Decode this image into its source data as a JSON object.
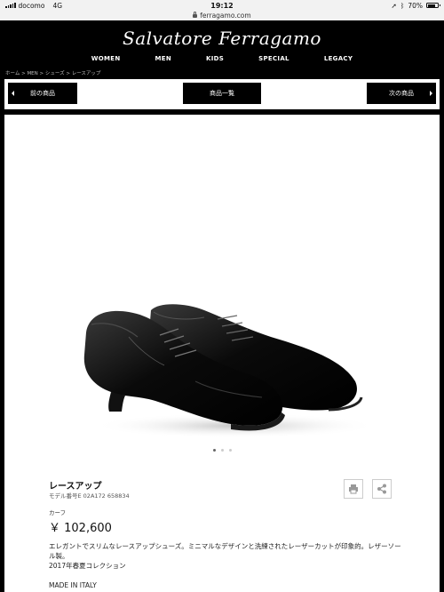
{
  "status_bar": {
    "carrier": "docomo",
    "network": "4G",
    "time": "19:12",
    "battery_percent": "70%",
    "battery_level": 0.7
  },
  "browser": {
    "url": "ferragamo.com"
  },
  "header": {
    "logo": "Salvatore Ferragamo",
    "nav": [
      "WOMEN",
      "MEN",
      "KIDS",
      "SPECIAL",
      "LEGACY"
    ]
  },
  "breadcrumb": "ホーム > MEN > シューズ > レースアップ",
  "pager": {
    "prev_label": "前の商品",
    "list_label": "商品一覧",
    "next_label": "次の商品"
  },
  "carousel": {
    "slide_count": 3,
    "active_index": 0
  },
  "product": {
    "name": "レースアップ",
    "model": "モデル番号E 02A172 658834",
    "material": "カーフ",
    "price": "￥ 102,600",
    "description": "エレガントでスリムなレースアップシューズ。ミニマルなデザインと洗練されたレーザーカットが印象的。レザーソール製。",
    "season": "2017年春夏コレクション",
    "origin": "MADE IN ITALY"
  },
  "icons": {
    "print": "print-icon",
    "share": "share-icon"
  },
  "colors": {
    "header_bg": "#000000",
    "header_text": "#ffffff",
    "button_bg": "#000000",
    "page_bg": "#ffffff"
  }
}
